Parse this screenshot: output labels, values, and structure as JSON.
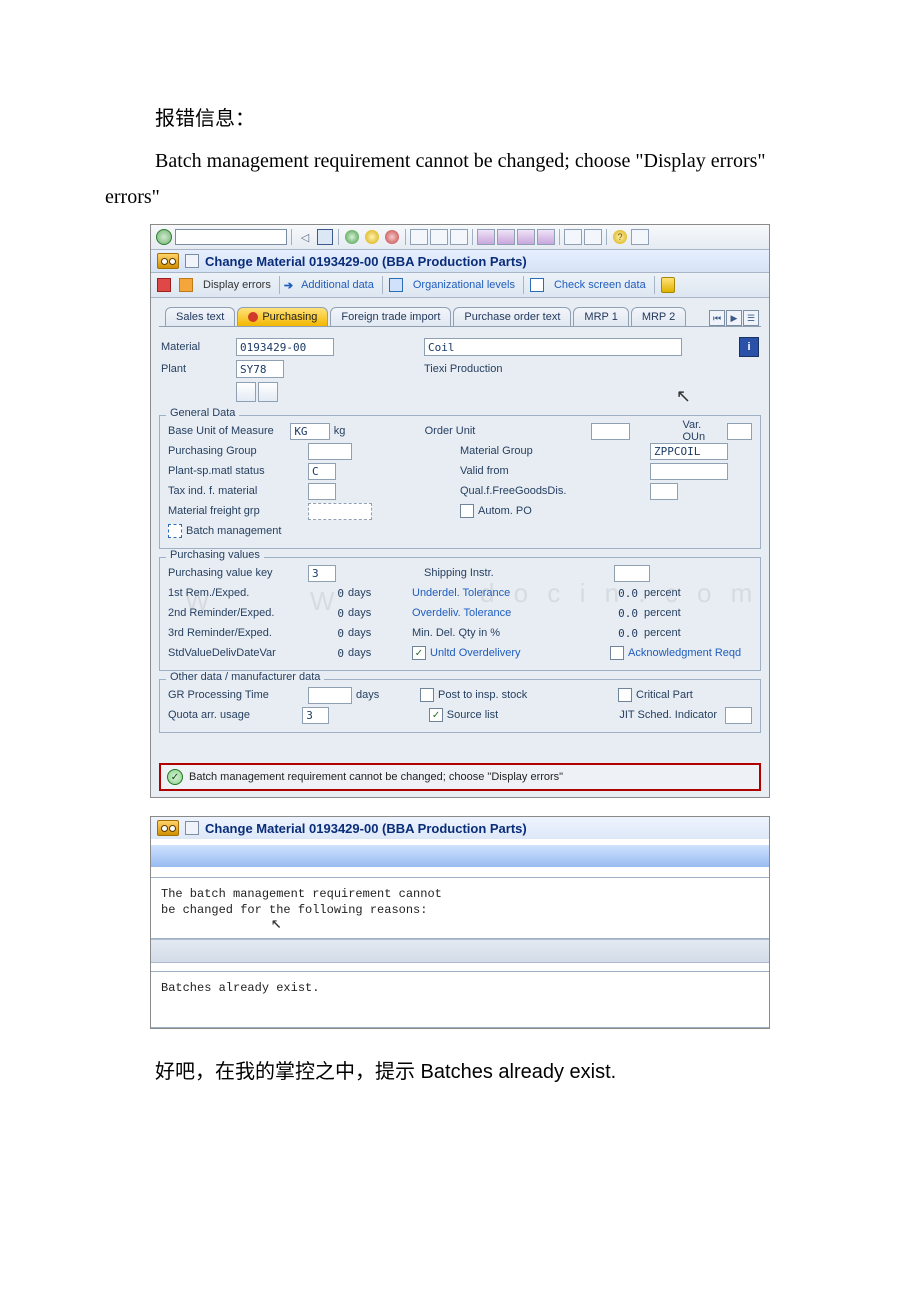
{
  "doc": {
    "heading": "报错信息：",
    "para_err": "Batch management requirement cannot be changed; choose \"Display errors\"",
    "footer": "好吧，在我的掌控之中，提示 Batches already exist."
  },
  "sap": {
    "title": "Change Material 0193429-00 (BBA Production Parts)",
    "appbar": {
      "display_errors": "Display errors",
      "additional_data": "Additional data",
      "org_levels": "Organizational levels",
      "check_screen": "Check screen data"
    },
    "tabs": {
      "sales_text": "Sales text",
      "purchasing": "Purchasing",
      "foreign_trade": "Foreign trade import",
      "po_text": "Purchase order text",
      "mrp1": "MRP 1",
      "mrp2": "MRP 2"
    },
    "header": {
      "material_lbl": "Material",
      "material_val": "0193429-00",
      "material_desc": "Coil",
      "plant_lbl": "Plant",
      "plant_val": "SY78",
      "plant_desc": "Tiexi Production"
    },
    "general": {
      "legend": "General Data",
      "bum_lbl": "Base Unit of Measure",
      "bum_val": "KG",
      "bum_unit": "kg",
      "order_unit_lbl": "Order Unit",
      "var_oun_lbl": "Var. OUn",
      "purch_group_lbl": "Purchasing Group",
      "mat_group_lbl": "Material Group",
      "mat_group_val": "ZPPCOIL",
      "plant_status_lbl": "Plant-sp.matl status",
      "plant_status_val": "C",
      "valid_from_lbl": "Valid from",
      "tax_ind_lbl": "Tax ind. f. material",
      "qual_free_lbl": "Qual.f.FreeGoodsDis.",
      "mat_freight_lbl": "Material freight grp",
      "autom_po_lbl": "Autom. PO",
      "batch_mgmt_lbl": "Batch management"
    },
    "purch_values": {
      "legend": "Purchasing values",
      "pvk_lbl": "Purchasing value key",
      "pvk_val": "3",
      "ship_instr_lbl": "Shipping Instr.",
      "rem1_lbl": "1st Rem./Exped.",
      "rem1_val": "0",
      "rem2_lbl": "2nd Reminder/Exped.",
      "rem2_val": "0",
      "rem3_lbl": "3rd Reminder/Exped.",
      "rem3_val": "0",
      "stdval_lbl": "StdValueDelivDateVar",
      "stdval_val": "0",
      "days": "days",
      "under_tol_lbl": "Underdel. Tolerance",
      "over_tol_lbl": "Overdeliv. Tolerance",
      "min_qty_lbl": "Min. Del. Qty in %",
      "unltd_lbl": "Unltd Overdelivery",
      "ack_reqd_lbl": "Acknowledgment Reqd",
      "zero_pct": "0.0",
      "percent": "percent"
    },
    "other": {
      "legend": "Other data / manufacturer data",
      "gr_time_lbl": "GR Processing Time",
      "post_insp_lbl": "Post to insp. stock",
      "critical_lbl": "Critical Part",
      "quota_lbl": "Quota arr. usage",
      "quota_val": "3",
      "source_list_lbl": "Source list",
      "jit_lbl": "JIT Sched. Indicator"
    },
    "status_msg": "Batch management requirement cannot be changed; choose \"Display errors\""
  },
  "sap2": {
    "title": "Change Material 0193429-00 (BBA Production Parts)",
    "line1": "The batch management requirement cannot",
    "line2": "be changed for the following reasons:",
    "line3": "Batches already exist."
  }
}
